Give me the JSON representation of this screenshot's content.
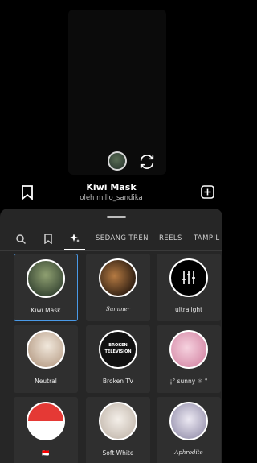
{
  "camera": {
    "avatar_icon": "effect-avatar-icon",
    "flip_icon": "camera-flip-icon"
  },
  "effect": {
    "name": "Kiwi Mask",
    "author": "oleh millo_sandika",
    "save_icon": "bookmark-icon",
    "add_icon": "add-to-gallery-icon"
  },
  "tabs": [
    {
      "icon": "search-icon",
      "label": ""
    },
    {
      "icon": "bookmark-icon",
      "label": ""
    },
    {
      "icon": "sparkle-icon",
      "label": "",
      "active": true
    },
    {
      "label": "SEDANG TREN"
    },
    {
      "label": "REELS"
    },
    {
      "label": "TAMPIL"
    }
  ],
  "effects": [
    {
      "label": "Kiwi Mask",
      "selected": true,
      "colors": [
        "#7e8f6a",
        "#3b4a36"
      ]
    },
    {
      "label": "Summer",
      "colors": [
        "#a06a3a",
        "#2a1d12"
      ]
    },
    {
      "label": "ultralight",
      "colors": [
        "#000000",
        "#000000"
      ]
    },
    {
      "label": "Neutral",
      "colors": [
        "#e9dfd2",
        "#b69c86"
      ]
    },
    {
      "label": "Broken TV",
      "colors": [
        "#111111",
        "#111111"
      ],
      "text": "BROKEN TELEVISION"
    },
    {
      "label": "¡° sunny ☼ °",
      "colors": [
        "#f3c2d2",
        "#d48ba7"
      ]
    },
    {
      "label": "🇮🇩",
      "colors": [
        "#e53935",
        "#ffffff"
      ]
    },
    {
      "label": "Soft White",
      "colors": [
        "#f2eeea",
        "#c7bdb3"
      ]
    },
    {
      "label": "Aphrodite",
      "colors": [
        "#e9e6f1",
        "#9a95b0"
      ]
    }
  ]
}
